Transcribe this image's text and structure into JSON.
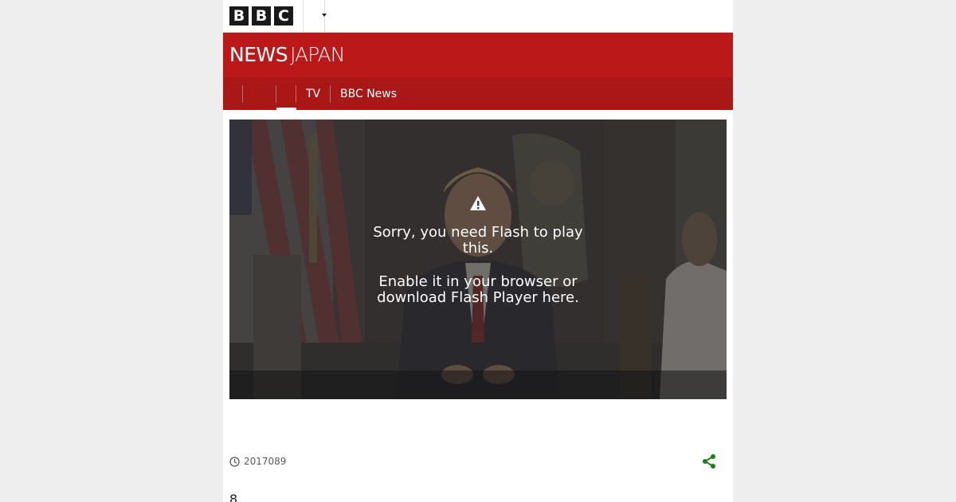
{
  "masthead": {
    "logo_letters": [
      "B",
      "B",
      "C"
    ],
    "menu_icon": "chevron-down-icon"
  },
  "header": {
    "brand_news": "NEWS",
    "brand_region": "JAPAN",
    "background_color": "#bb1919"
  },
  "nav": {
    "items": [
      {
        "label": ""
      },
      {
        "label": ""
      },
      {
        "label": "TV"
      },
      {
        "label": "BBC News"
      }
    ],
    "active_index": 1,
    "bar_color": "#a91717"
  },
  "player": {
    "icon": "warning-icon",
    "message_line1": "Sorry, you need Flash to play this.",
    "message_line2": "Enable it in your browser or download Flash Player here."
  },
  "meta": {
    "clock_icon": "clock-icon",
    "date": "2017089",
    "share_icon": "share-icon",
    "share_color": "#1a7f1a"
  },
  "article": {
    "first_text": "8"
  }
}
